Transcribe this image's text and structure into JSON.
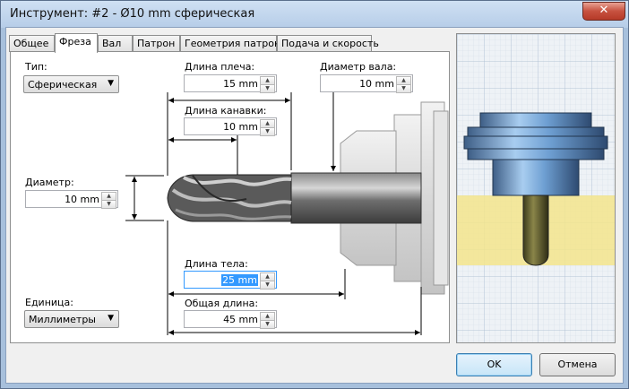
{
  "window": {
    "title": "Инструмент: #2 - Ø10 mm сферическая",
    "close_glyph": "✕"
  },
  "tabs": [
    {
      "label": "Общее"
    },
    {
      "label": "Фреза"
    },
    {
      "label": "Вал"
    },
    {
      "label": "Патрон"
    },
    {
      "label": "Геометрия патрона"
    },
    {
      "label": "Подача и скорость"
    }
  ],
  "active_tab": "Фреза",
  "form": {
    "type_label": "Тип:",
    "type_value": "Сферическая фреза",
    "diameter_label": "Диаметр:",
    "diameter_value": "10 mm",
    "shoulder_label": "Длина плеча:",
    "shoulder_value": "15 mm",
    "flute_label": "Длина канавки:",
    "flute_value": "10 mm",
    "shaft_label": "Диаметр вала:",
    "shaft_value": "10 mm",
    "body_label": "Длина тела:",
    "body_value": "25 mm",
    "total_label": "Общая длина:",
    "total_value": "45 mm",
    "unit_label": "Единица:",
    "unit_value": "Миллиметры"
  },
  "buttons": {
    "ok": "OK",
    "cancel": "Отмена"
  },
  "colors": {
    "accent": "#3399ff",
    "holder": "#5b8fc9",
    "stock": "#f3e58c"
  }
}
